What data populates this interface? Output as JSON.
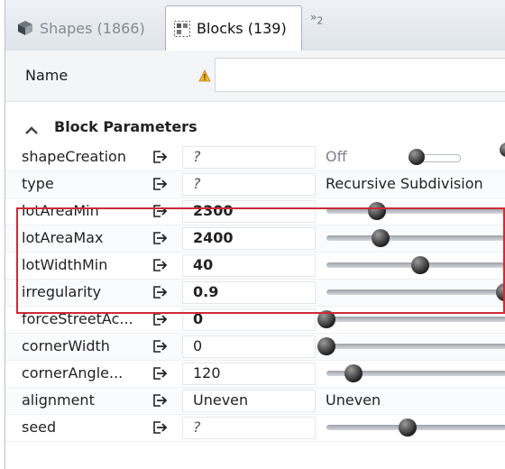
{
  "tabs": [
    {
      "label": "Shapes (1866)",
      "icon": "cube-icon",
      "active": false
    },
    {
      "label": "Blocks (139)",
      "icon": "blocks-icon",
      "active": true
    }
  ],
  "tab_overflow": {
    "symbol": "»",
    "count": "2"
  },
  "name_row": {
    "label": "Name",
    "icon": "warning-icon",
    "value": ""
  },
  "section": {
    "title": "Block Parameters",
    "icon": "chevron-up-icon"
  },
  "highlight_color": "#cc2b36",
  "params": [
    {
      "name": "shapeCreation",
      "value": "?",
      "style": "italic",
      "control": "toggle",
      "control_text": "Off",
      "toggle_on": false
    },
    {
      "name": "type",
      "value": "?",
      "style": "italic",
      "control": "text",
      "control_text": "Recursive Subdivision"
    },
    {
      "name": "lotAreaMin",
      "value": "2300",
      "style": "bold",
      "control": "slider",
      "slider_level": 0.28
    },
    {
      "name": "lotAreaMax",
      "value": "2400",
      "style": "bold",
      "control": "slider",
      "slider_level": 0.3
    },
    {
      "name": "lotWidthMin",
      "value": "40",
      "style": "bold",
      "control": "slider",
      "slider_level": 0.52
    },
    {
      "name": "irregularity",
      "value": "0.9",
      "style": "bold",
      "control": "slider",
      "slider_level": 0.99
    },
    {
      "name": "forceStreetAc...",
      "value": "0",
      "style": "bold",
      "control": "slider",
      "slider_level": 0.0
    },
    {
      "name": "cornerWidth",
      "value": "0",
      "style": "normal",
      "control": "slider",
      "slider_level": 0.0
    },
    {
      "name": "cornerAngle...",
      "value": "120",
      "style": "normal",
      "control": "slider",
      "slider_level": 0.15
    },
    {
      "name": "alignment",
      "value": "Uneven",
      "style": "normal",
      "control": "text",
      "control_text": "Uneven"
    },
    {
      "name": "seed",
      "value": "?",
      "style": "italic",
      "control": "slider",
      "slider_level": 0.45
    }
  ]
}
